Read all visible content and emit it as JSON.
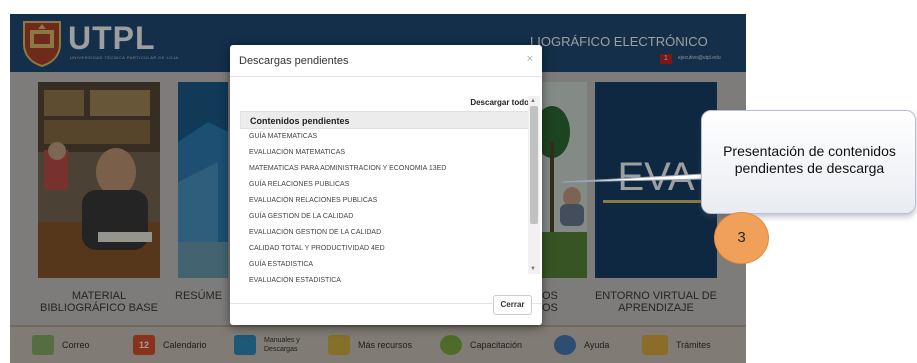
{
  "header": {
    "brand": "UTPL",
    "brand_subtitle": "UNIVERSIDAD TÉCNICA PARTICULAR DE LOJA",
    "title_partial": "LIOGRÁFICO ELECTRÓNICO",
    "badge": "1",
    "user_name": "ejecutivo@utpl.edu"
  },
  "tiles": [
    {
      "label": "MATERIAL BIBLIOGRÁFICO BASE"
    },
    {
      "label": "RESÚME"
    },
    {
      "label": "OS OS"
    },
    {
      "label": "ENTORNO VIRTUAL DE APRENDIZAJE"
    }
  ],
  "eva_text": "EVA",
  "toolbar": {
    "correo": "Correo",
    "calendario_num": "12",
    "calendario": "Calendario",
    "manuales": "Manuales y Descargas",
    "recursos": "Más recursos",
    "capacitacion": "Capacitación",
    "ayuda": "Ayuda",
    "tramites": "Trámites"
  },
  "modal": {
    "title": "Descargas pendientes",
    "close_icon": "×",
    "download_all": "Descargar todo",
    "list_header": "Contenidos pendientes",
    "items": [
      "GUÍA MATEMATICAS",
      "EVALUACIÓN MATEMATICAS",
      "MATEMATICAS PARA ADMINISTRACION Y ECONOMIA 13ED",
      "GUÍA RELACIONES PUBLICAS",
      "EVALUACIÓN RELACIONES PUBLICAS",
      "GUÍA GESTION DE LA CALIDAD",
      "EVALUACIÓN GESTION DE LA CALIDAD",
      "CALIDAD TOTAL Y PRODUCTIVIDAD 4ED",
      "GUÍA ESTADISTICA",
      "EVALUACIÓN ESTADISTICA"
    ],
    "close_button": "Cerrar"
  },
  "callout": {
    "text": "Presentación de contenidos pendientes de descarga",
    "step": "3"
  },
  "colors": {
    "header_bg": "#1f4c78",
    "step_circle": "#f0a058",
    "eva_bg": "#163a5e"
  }
}
